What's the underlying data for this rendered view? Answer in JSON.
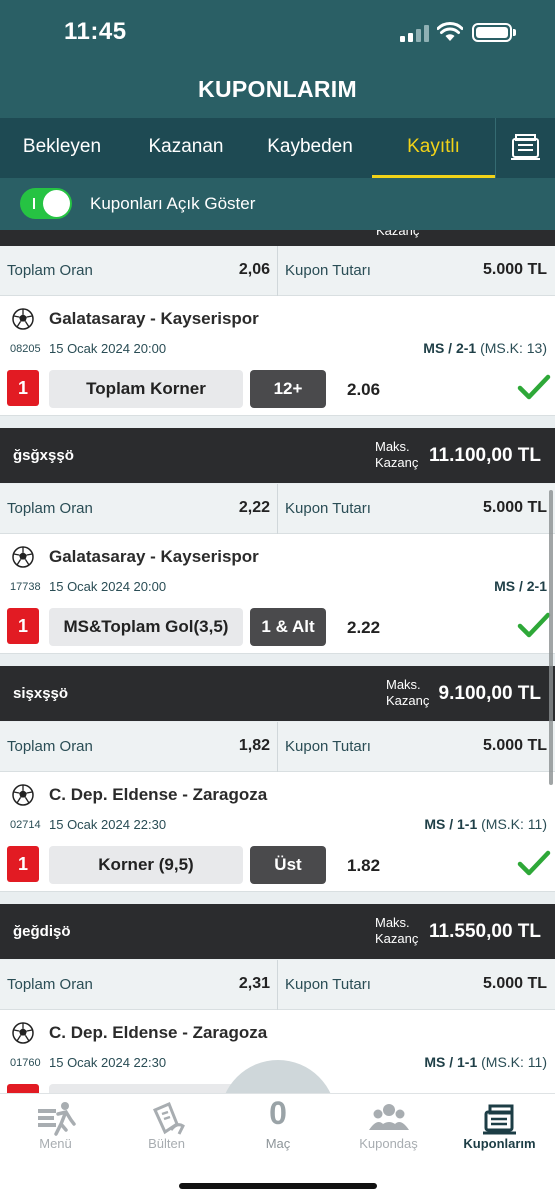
{
  "status_bar": {
    "time": "11:45"
  },
  "header": {
    "title": "KUPONLARIM"
  },
  "tabs": [
    {
      "label": "Bekleyen"
    },
    {
      "label": "Kazanan"
    },
    {
      "label": "Kaybeden"
    },
    {
      "label": "Kayıtlı",
      "active": true
    }
  ],
  "toggle": {
    "label": "Kuponları Açık Göster",
    "on": true
  },
  "partial_top": {
    "maks_fragment": "Kazanç"
  },
  "labels": {
    "toplam_oran": "Toplam Oran",
    "kupon_tutari": "Kupon Tutarı",
    "maks": "Maks.",
    "kazanc": "Kazanç"
  },
  "coupons": [
    {
      "name": "",
      "toplam_oran": "2,06",
      "kupon_tutari": "5.000 TL",
      "match": {
        "teams": "Galatasaray - Kayserispor",
        "code": "08205",
        "date": "15 Ocak 2024 20:00",
        "result_bold": "MS / 2-1",
        "result_extra": " (MS.K: 13)",
        "badge": "1",
        "market": "Toplam Korner",
        "selection": "12+",
        "odd": "2.06",
        "won": true
      }
    },
    {
      "name": "ğsğxşşö",
      "max_win": "11.100,00 TL",
      "toplam_oran": "2,22",
      "kupon_tutari": "5.000 TL",
      "match": {
        "teams": "Galatasaray - Kayserispor",
        "code": "17738",
        "date": "15 Ocak 2024 20:00",
        "result_bold": "MS / 2-1",
        "result_extra": "",
        "badge": "1",
        "market": "MS&Toplam Gol(3,5)",
        "selection": "1 & Alt",
        "odd": "2.22",
        "won": true
      }
    },
    {
      "name": "sişxşşö",
      "max_win": "9.100,00 TL",
      "toplam_oran": "1,82",
      "kupon_tutari": "5.000 TL",
      "match": {
        "teams": "C. Dep. Eldense - Zaragoza",
        "code": "02714",
        "date": "15 Ocak 2024 22:30",
        "result_bold": "MS / 1-1",
        "result_extra": " (MS.K: 11)",
        "badge": "1",
        "market": "Korner (9,5)",
        "selection": "Üst",
        "odd": "1.82",
        "won": true
      }
    },
    {
      "name": "ğeğdişö",
      "max_win": "11.550,00 TL",
      "toplam_oran": "2,31",
      "kupon_tutari": "5.000 TL",
      "match": {
        "teams": "C. Dep. Eldense - Zaragoza",
        "code": "01760",
        "date": "15 Ocak 2024 22:30",
        "result_bold": "MS / 1-1",
        "result_extra": " (MS.K: 11)",
        "badge": "1",
        "market": "",
        "selection": "",
        "odd": "",
        "won": false
      }
    }
  ],
  "bottom_nav": {
    "items": [
      {
        "label": "Menü",
        "icon": "menu-runner-icon"
      },
      {
        "label": "Bülten",
        "icon": "bulletin-hand-icon"
      },
      {
        "label": "Maç",
        "count": "0"
      },
      {
        "label": "Kupondaş",
        "icon": "people-icon"
      },
      {
        "label": "Kuponlarım",
        "icon": "coupons-icon",
        "active": true
      }
    ]
  },
  "colors": {
    "header": "#2a5f65",
    "tab_bar": "#1e4a53",
    "active_tab": "#f2d318",
    "badge_red": "#e21b23",
    "win_green": "#2ea838",
    "dark_bar": "#2b2c2e"
  }
}
